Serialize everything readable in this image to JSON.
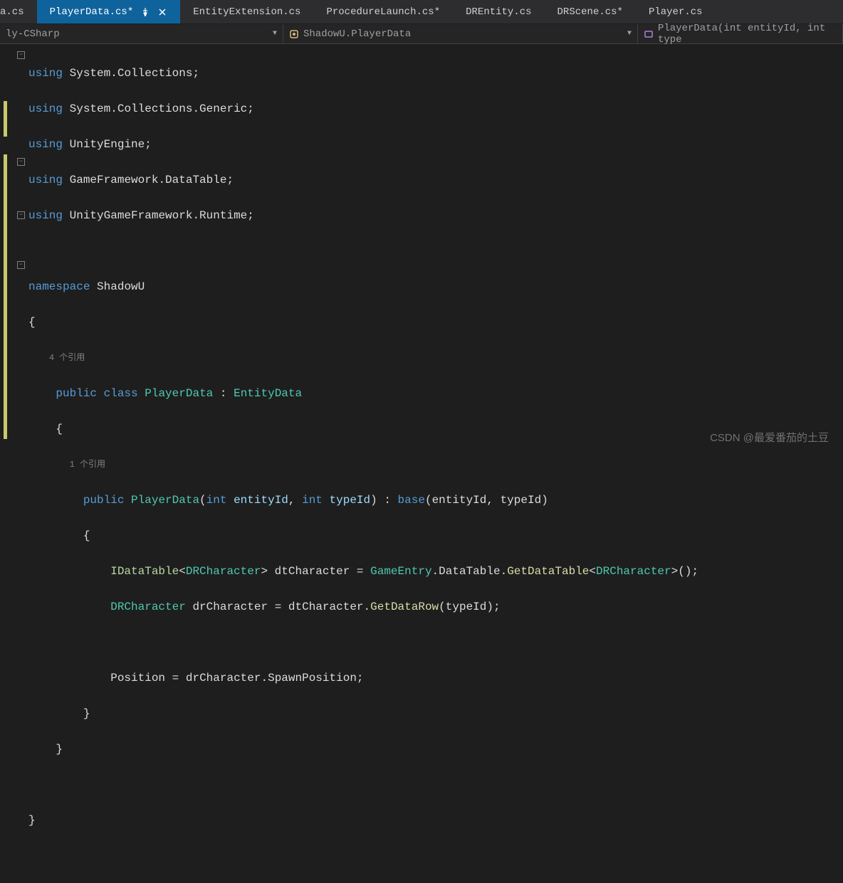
{
  "tabs": {
    "partial_left": "a.cs",
    "items": [
      {
        "label": "PlayerData.cs*",
        "active": true,
        "pinned": true,
        "closable": true
      },
      {
        "label": "EntityExtension.cs",
        "active": false
      },
      {
        "label": "ProcedureLaunch.cs*",
        "active": false
      },
      {
        "label": "DREntity.cs",
        "active": false
      },
      {
        "label": "DRScene.cs*",
        "active": false
      },
      {
        "label": "Player.cs",
        "active": false
      }
    ]
  },
  "nav": {
    "project": "ly-CSharp",
    "class": "ShadowU.PlayerData",
    "method": "PlayerData(int entityId, int type"
  },
  "codelens": {
    "class_refs": "4 个引用",
    "ctor_refs": "1 个引用"
  },
  "code": {
    "usings": [
      {
        "kw": "using",
        "ns": "System.Collections"
      },
      {
        "kw": "using",
        "ns": "System.Collections.Generic"
      },
      {
        "kw": "using",
        "ns": "UnityEngine"
      },
      {
        "kw": "using",
        "ns": "GameFramework.DataTable"
      },
      {
        "kw": "using",
        "ns": "UnityGameFramework.Runtime"
      }
    ],
    "namespace_kw": "namespace",
    "namespace_name": "ShadowU",
    "class_decl": {
      "public": "public",
      "class": "class",
      "name": "PlayerData",
      "colon": ":",
      "base": "EntityData"
    },
    "ctor": {
      "public": "public",
      "name": "PlayerData",
      "int1": "int",
      "p1": "entityId",
      "int2": "int",
      "p2": "typeId",
      "colon": ":",
      "base": "base",
      "a1": "entityId",
      "a2": "typeId"
    },
    "line1": {
      "iface": "IDataTable",
      "gen": "DRCharacter",
      "var": "dtCharacter",
      "eq": "=",
      "cls": "GameEntry",
      "prop": "DataTable",
      "method": "GetDataTable",
      "gen2": "DRCharacter"
    },
    "line2": {
      "type": "DRCharacter",
      "var": "drCharacter",
      "eq": "=",
      "obj": "dtCharacter",
      "method": "GetDataRow",
      "arg": "typeId"
    },
    "line3": {
      "prop": "Position",
      "eq": "=",
      "obj": "drCharacter",
      "field": "SpawnPosition"
    }
  },
  "watermark": "CSDN @最爱番茄的土豆"
}
